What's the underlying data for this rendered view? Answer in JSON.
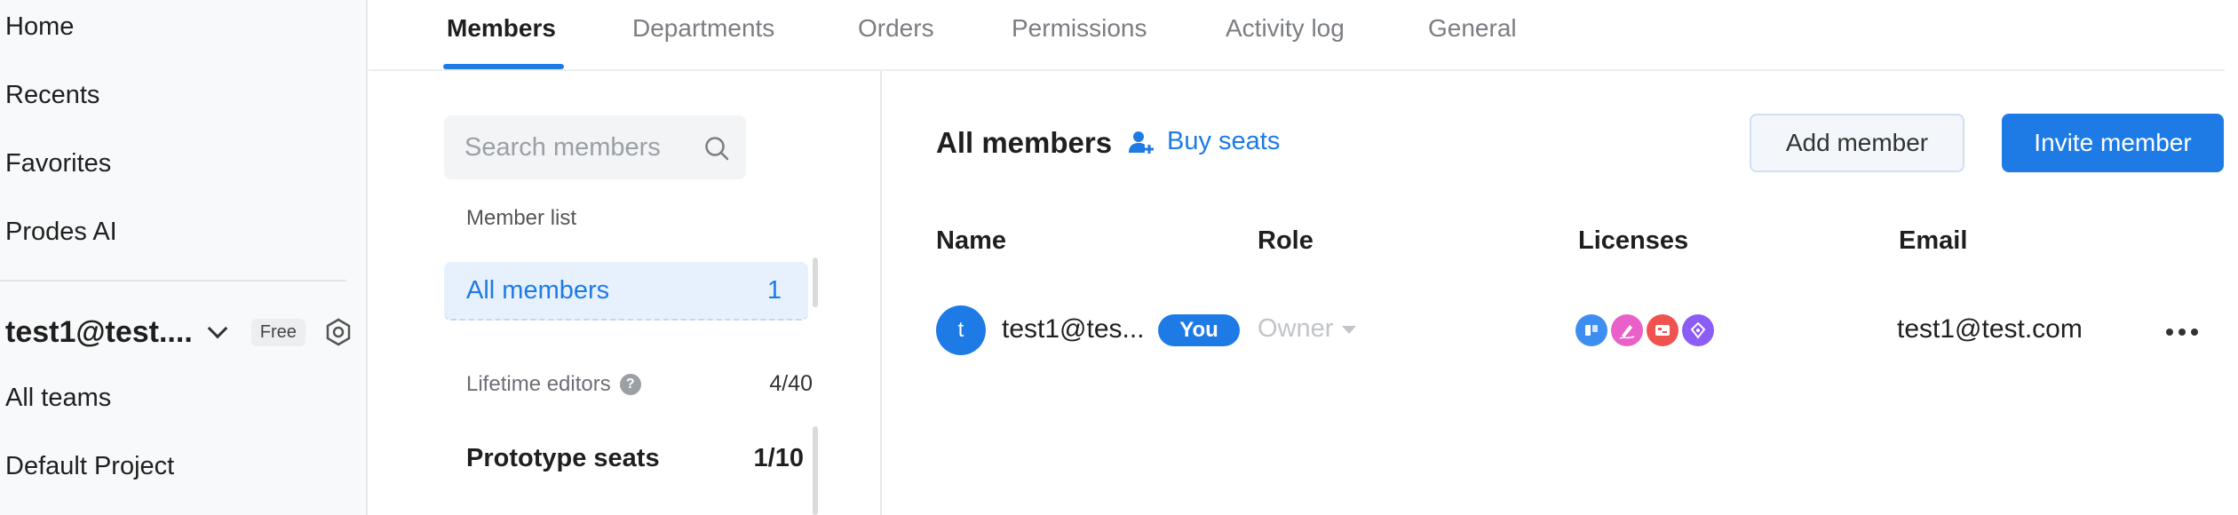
{
  "sidebar": {
    "nav": [
      "Home",
      "Recents",
      "Favorites",
      "Prodes AI"
    ],
    "team_name": "test1@test....",
    "plan_badge": "Free",
    "links": [
      "All teams",
      "Default Project"
    ]
  },
  "tabs": [
    "Members",
    "Departments",
    "Orders",
    "Permissions",
    "Activity log",
    "General"
  ],
  "active_tab": "Members",
  "left_panel": {
    "search_placeholder": "Search members",
    "section_label": "Member list",
    "all_members_label": "All members",
    "all_members_count": "1",
    "lifetime_label": "Lifetime editors",
    "lifetime_help": "?",
    "lifetime_count": "4/40",
    "prototype_label": "Prototype seats",
    "prototype_count": "1/10"
  },
  "main": {
    "title": "All members",
    "buy_seats": "Buy seats",
    "add_member": "Add member",
    "invite_member": "Invite member",
    "columns": [
      "Name",
      "Role",
      "Licenses",
      "Email"
    ],
    "members": [
      {
        "initial": "t",
        "name": "test1@tes...",
        "badge": "You",
        "role": "Owner",
        "email": "test1@test.com",
        "licenses": [
          {
            "icon": "board-icon",
            "color": "#3d8ef0"
          },
          {
            "icon": "pen-draw-icon",
            "color": "#e960c8"
          },
          {
            "icon": "screen-icon",
            "color": "#ef5350"
          },
          {
            "icon": "pen-nib-icon",
            "color": "#8b5cf6"
          }
        ]
      }
    ]
  },
  "colors": {
    "accent": "#1e7be6",
    "sidebar_bg": "#f8f9fa",
    "selected_bg": "#e7f1fd"
  }
}
